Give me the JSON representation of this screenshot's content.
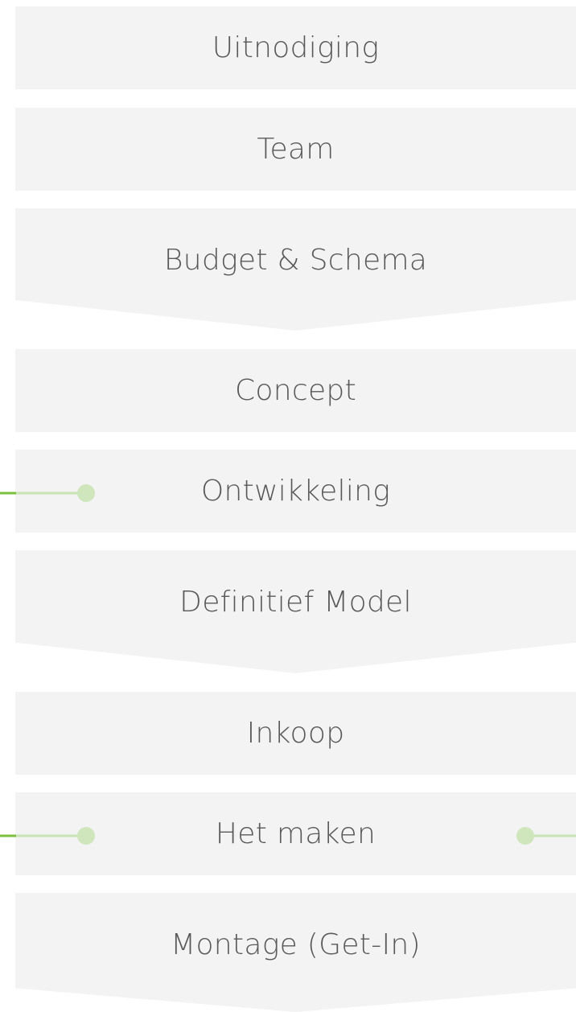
{
  "stages": [
    {
      "steps": [
        "Uitnodiging",
        "Team",
        "Budget & Schema"
      ]
    },
    {
      "steps": [
        "Concept",
        "Ontwikkeling",
        "Definitief Model"
      ]
    },
    {
      "steps": [
        "Inkoop",
        "Het maken",
        "Montage (Get-In)"
      ]
    }
  ],
  "colors": {
    "box_fill": "#f3f3f3",
    "text": "#595959",
    "connector_line": "#c9e3b3",
    "connector_edge": "#7cbf3c",
    "connector_dot": "#cfe6bd"
  }
}
